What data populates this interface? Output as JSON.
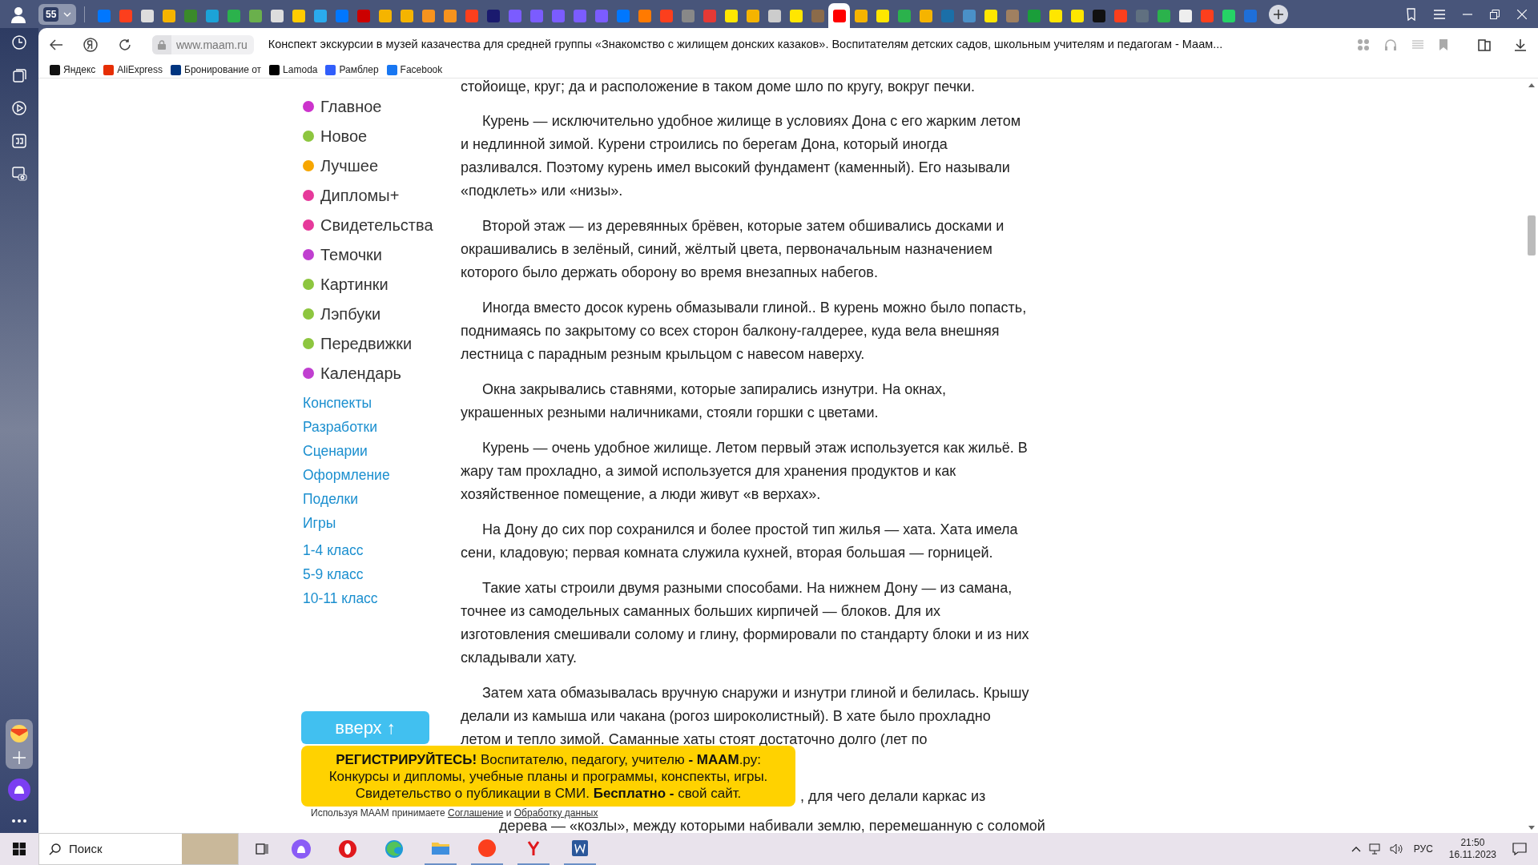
{
  "browser": {
    "profile_tab": {
      "label": "55"
    },
    "tabs": [
      {
        "color": "#0077ff",
        "selected": false
      },
      {
        "color": "#fc3f1d",
        "selected": false
      },
      {
        "color": "#dddddd",
        "selected": false
      },
      {
        "color": "#f5b400",
        "selected": false
      },
      {
        "color": "#3a8a2a",
        "selected": false
      },
      {
        "color": "#1ca3d8",
        "selected": false
      },
      {
        "color": "#2bb24c",
        "selected": false
      },
      {
        "color": "#6ab04c",
        "selected": false
      },
      {
        "color": "#dddddd",
        "selected": false
      },
      {
        "color": "#ffcc00",
        "selected": false
      },
      {
        "color": "#2aabee",
        "selected": false
      },
      {
        "color": "#0077ff",
        "selected": false
      },
      {
        "color": "#cc0000",
        "selected": false
      },
      {
        "color": "#f5b400",
        "selected": false
      },
      {
        "color": "#f5b400",
        "selected": false
      },
      {
        "color": "#f7931e",
        "selected": false
      },
      {
        "color": "#f7931e",
        "selected": false
      },
      {
        "color": "#fc3f1d",
        "selected": false
      },
      {
        "color": "#1a1a6e",
        "selected": false
      },
      {
        "color": "#7b5cff",
        "selected": false
      },
      {
        "color": "#7b5cff",
        "selected": false
      },
      {
        "color": "#7b5cff",
        "selected": false
      },
      {
        "color": "#7b5cff",
        "selected": false
      },
      {
        "color": "#7b5cff",
        "selected": false
      },
      {
        "color": "#0077ff",
        "selected": false
      },
      {
        "color": "#ff7a00",
        "selected": false
      },
      {
        "color": "#fc3f1d",
        "selected": false
      },
      {
        "color": "#888888",
        "selected": false
      },
      {
        "color": "#e53935",
        "selected": false
      },
      {
        "color": "#ffe600",
        "selected": false
      },
      {
        "color": "#f5b400",
        "selected": false
      },
      {
        "color": "#cccccc",
        "selected": false
      },
      {
        "color": "#ffe600",
        "selected": false
      },
      {
        "color": "#8b6b4a",
        "selected": false
      },
      {
        "color": "#ff0000",
        "selected": true
      },
      {
        "color": "#f5b400",
        "selected": false
      },
      {
        "color": "#ffe600",
        "selected": false
      },
      {
        "color": "#2bb24c",
        "selected": false
      },
      {
        "color": "#f5b400",
        "selected": false
      },
      {
        "color": "#1b6fa8",
        "selected": false
      },
      {
        "color": "#4a90c8",
        "selected": false
      },
      {
        "color": "#ffe600",
        "selected": false
      },
      {
        "color": "#a08060",
        "selected": false
      },
      {
        "color": "#1a9e3a",
        "selected": false
      },
      {
        "color": "#ffe600",
        "selected": false
      },
      {
        "color": "#ffe600",
        "selected": false
      },
      {
        "color": "#111111",
        "selected": false
      },
      {
        "color": "#fc3f1d",
        "selected": false
      },
      {
        "color": "#607080",
        "selected": false
      },
      {
        "color": "#2bb24c",
        "selected": false
      },
      {
        "color": "#eeeeee",
        "selected": false
      },
      {
        "color": "#fc3f1d",
        "selected": false
      },
      {
        "color": "#25d366",
        "selected": false
      },
      {
        "color": "#1e6fd9",
        "selected": false
      }
    ],
    "address": "www.maam.ru",
    "page_title": "Конспект экскурсии в музей казачества для средней группы «Знакомство с жилищем донских казаков». Воспитателям детских садов, школьным учителям и педагогам - Маам...",
    "bookmarks": [
      {
        "label": "Яндекс",
        "color": "#111111"
      },
      {
        "label": "AliExpress",
        "color": "#e62e04"
      },
      {
        "label": "Бронирование от",
        "color": "#003580"
      },
      {
        "label": "Lamoda",
        "color": "#000000"
      },
      {
        "label": "Рамблер",
        "color": "#315efb"
      },
      {
        "label": "Facebook",
        "color": "#1877f2"
      }
    ]
  },
  "site_nav": {
    "categories": [
      {
        "label": "Главное",
        "color": "#cc33cc"
      },
      {
        "label": "Новое",
        "color": "#8dc63f"
      },
      {
        "label": "Лучшее",
        "color": "#f7a600"
      },
      {
        "label": "Дипломы+",
        "color": "#e6399b"
      },
      {
        "label": "Свидетельства",
        "color": "#e6399b"
      },
      {
        "label": "Темочки",
        "color": "#c03fd0"
      },
      {
        "label": "Картинки",
        "color": "#8dc63f"
      },
      {
        "label": "Лэпбуки",
        "color": "#8dc63f"
      },
      {
        "label": "Передвижки",
        "color": "#8dc63f"
      },
      {
        "label": "Календарь",
        "color": "#c03fd0"
      }
    ],
    "links": [
      "Конспекты",
      "Разработки",
      "Сценарии",
      "Оформление",
      "Поделки",
      "Игры"
    ],
    "grades": [
      "1-4 класс",
      "5-9 класс",
      "10-11 класс"
    ]
  },
  "article": {
    "top_line": "стойоище, круг; да и расположение в таком доме шло по кругу, вокруг печки.",
    "paragraphs": [
      "Курень — исключительно удобное жилище в условиях Дона с его жарким летом и недлинной зимой. Курени строились по берегам Дона, который иногда разливался. Поэтому курень имел высокий фундамент (каменный). Его называли «подклеть» или «низы».",
      "Второй этаж — из деревянных брёвен, которые затем обшивались досками и окрашивались в зелёный, синий, жёлтый цвета, первоначальным назначением которого было держать оборону во время внезапных набегов.",
      "Иногда вместо досок курень обмазывали глиной.. В курень можно было попасть, поднимаясь по закрытому со всех сторон балкону-галдерее, куда вела внешняя лестница с парадным резным крыльцом с навесом наверху.",
      "Окна закрывались ставнями, которые запирались изнутри. На окнах, украшенных резными наличниками, стояли горшки с цветами.",
      "Курень — очень удобное жилище. Летом первый этаж используется как жильё. В жару там прохладно, а зимой используется для хранения продуктов и как хозяйственное помещение, а люди живут «в верхах».",
      "На Дону до сих пор сохранился и более простой тип жилья — хата. Хата имела сени, кладовую; первая комната служила кухней, вторая большая — горницей.",
      "Такие хаты строили двумя разными способами. На нижнем Дону — из самана, точнее из самодельных саманных больших кирпичей — блоков. Для их изготовления смешивали солому и глину, формировали по стандарту блоки и из них складывали хату.",
      "Затем хата обмазывалась вручную снаружи и изнутри глиной и белилась. Крышу делали из камыша или чакана (рогоз широколистный). В хате было прохладно летом и тепло зимой. Саманные хаты стоят достаточно долго (лет по"
    ],
    "fragment_1": ", для чего делали каркас из",
    "fragment_2": "дерева — «козлы», между которыми набивали землю, перемешанную с соломой"
  },
  "up_button": "вверх ↑",
  "banner": [
    "**РЕГИСТРИРУЙТЕСЬ!** Воспитателю, педагогу, учителю **- МААМ**.ру:",
    "Конкурсы и дипломы, учебные планы и программы, конспекты, игры.",
    "Свидетельство о публикации в СМИ. **Бесплатно -** свой сайт."
  ],
  "consent": {
    "text": "Используя МААМ принимаете",
    "link_1": "Соглашение",
    "joiner": "и",
    "link_2": "Обработку данных"
  },
  "taskbar": {
    "search_placeholder": "Поиск",
    "language": "РУС",
    "time": "21:50",
    "date": "16.11.2023"
  }
}
